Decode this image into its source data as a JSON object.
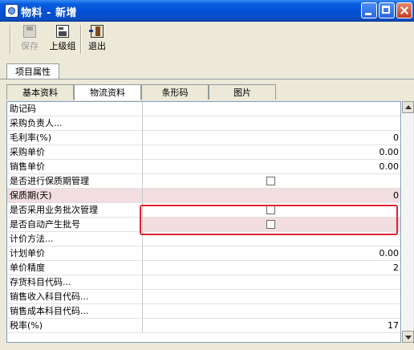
{
  "window": {
    "title": "物料 - 新增"
  },
  "toolbar": {
    "save_label": "保存",
    "parent_label": "上级组",
    "exit_label": "退出"
  },
  "section_tab": {
    "label": "项目属性"
  },
  "tabs": [
    {
      "label": "基本资料",
      "active": false
    },
    {
      "label": "物流资料",
      "active": true
    },
    {
      "label": "条形码",
      "active": false
    },
    {
      "label": "图片",
      "active": false
    }
  ],
  "rows": [
    {
      "label": "助记码",
      "value": ""
    },
    {
      "label": "采购负责人...",
      "value": ""
    },
    {
      "label": "毛利率(%)",
      "value": "0"
    },
    {
      "label": "采购单价",
      "value": "0.00"
    },
    {
      "label": "销售单价",
      "value": "0.00"
    },
    {
      "label": "是否进行保质期管理",
      "value": "",
      "checkbox": true
    },
    {
      "label": "保质期(天)",
      "value": "0",
      "shaded": true
    },
    {
      "label": "是否采用业务批次管理",
      "value": "",
      "checkbox": true
    },
    {
      "label": "是否自动产生批号",
      "value": "",
      "checkbox": true,
      "shaded": true
    },
    {
      "label": "计价方法...",
      "value": ""
    },
    {
      "label": "计划单价",
      "value": "0.00"
    },
    {
      "label": "单价精度",
      "value": "2"
    },
    {
      "label": "存货科目代码...",
      "value": ""
    },
    {
      "label": "销售收入科目代码...",
      "value": ""
    },
    {
      "label": "销售成本科目代码...",
      "value": ""
    },
    {
      "label": "税率(%)",
      "value": "17"
    }
  ],
  "colors": {
    "highlight": "#E0202A",
    "shaded_cell": "#F2DDE0",
    "titlebar": "#0350D6"
  }
}
